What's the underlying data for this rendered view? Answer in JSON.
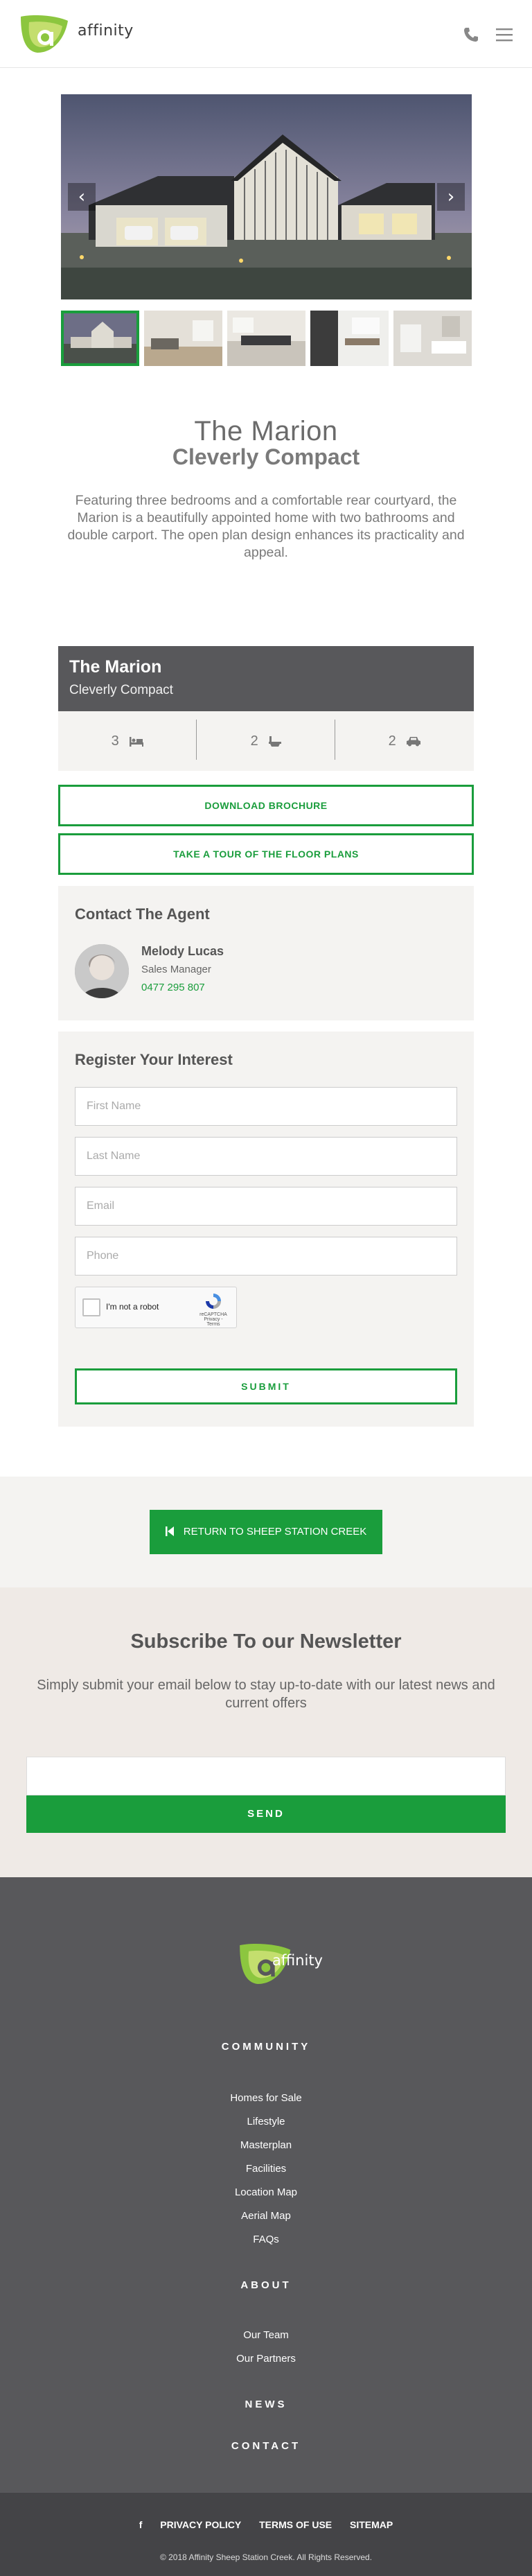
{
  "header": {
    "logo_text": "affinity",
    "phone_icon": "phone-icon",
    "menu_icon": "hamburger-menu-icon"
  },
  "slider": {
    "prev_label": "‹",
    "next_label": "›",
    "thumbnail_count": 5,
    "active_index": 0
  },
  "home": {
    "name": "The Marion",
    "collection": "Cleverly Compact",
    "description": "Featuring three bedrooms and a comfortable rear courtyard, the Marion is a beautifully appointed home with two bathrooms and double carport. The open plan design enhances its practicality and appeal.",
    "specs": {
      "bedrooms": "3",
      "bathrooms": "2",
      "cars": "2"
    }
  },
  "buttons": {
    "brochure": "DOWNLOAD BROCHURE",
    "tour": "TAKE A TOUR OF THE FLOOR PLANS"
  },
  "agent": {
    "title": "Contact The Agent",
    "name": "Melody Lucas",
    "role": "Sales Manager",
    "phone": "0477 295 807"
  },
  "register": {
    "title": "Register Your Interest",
    "first_name": "First Name",
    "last_name": "Last Name",
    "email": "Email",
    "phone": "Phone",
    "captcha_label": "I'm not a robot",
    "captcha_brand": "reCAPTCHA",
    "captcha_terms": "Privacy - Terms",
    "submit": "SUBMIT"
  },
  "return": {
    "label": "RETURN TO SHEEP STATION CREEK"
  },
  "newsletter": {
    "title": "Subscribe To our Newsletter",
    "description": "Simply submit your email below to stay up-to-date with our latest news and current offers",
    "send": "SEND"
  },
  "footer": {
    "logo_text": "affinity",
    "community_heading": "COMMUNITY",
    "community_links": [
      "Homes for Sale",
      "Lifestyle",
      "Masterplan",
      "Facilities",
      "Location Map",
      "Aerial Map",
      "FAQs"
    ],
    "about_heading": "ABOUT",
    "about_links": [
      "Our Team",
      "Our Partners"
    ],
    "news_heading": "NEWS",
    "contact_heading": "CONTACT",
    "bottom_links": [
      "PRIVACY POLICY",
      "TERMS OF USE",
      "SITEMAP"
    ],
    "facebook_icon": "f",
    "copyright": "© 2018 Affinity Sheep Station Creek. All Rights Reserved."
  },
  "colors": {
    "brand_green": "#1a9d3c",
    "logo_lime": "#8cc63f",
    "dark_grey": "#58585b"
  }
}
